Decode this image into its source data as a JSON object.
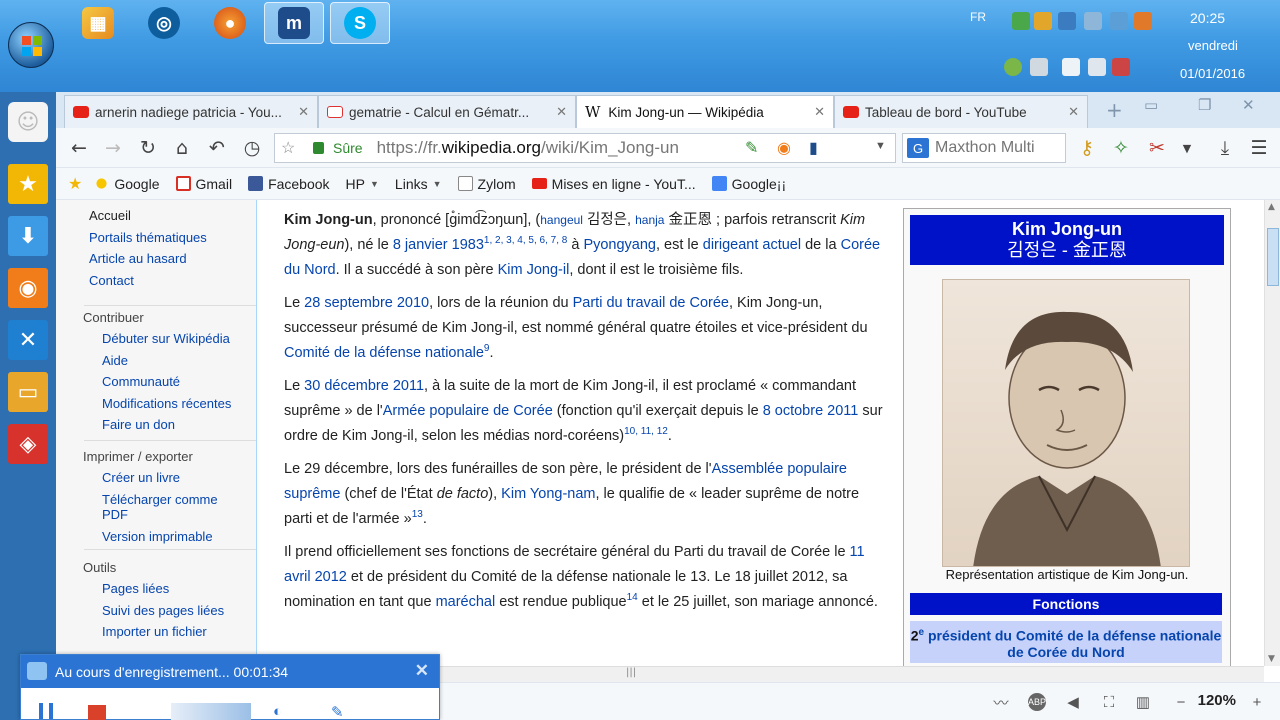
{
  "taskbar": {
    "language": "FR",
    "time": "20:25",
    "day": "vendredi",
    "date": "01/01/2016"
  },
  "tabs": [
    {
      "label": "arnerin nadiege patricia - You...",
      "favicon": "youtube-icon",
      "active": false
    },
    {
      "label": "gematrie - Calcul en Gématr...",
      "favicon": "site-icon",
      "active": false
    },
    {
      "label": "Kim Jong-un — Wikipédia",
      "favicon": "wikipedia-icon",
      "active": true
    },
    {
      "label": "Tableau de bord - YouTube",
      "favicon": "youtube-icon",
      "active": false
    }
  ],
  "address": {
    "secure_label": "Sûre",
    "url_prefix": "https://fr.",
    "url_domain": "wikipedia.org",
    "url_path": "/wiki/Kim_Jong-un"
  },
  "search": {
    "placeholder": "Maxthon Multi"
  },
  "bookmarks": [
    {
      "label": "Google",
      "icon": "sun-icon",
      "dropdown": false
    },
    {
      "label": "Gmail",
      "icon": "gmail-icon",
      "dropdown": false
    },
    {
      "label": "Facebook",
      "icon": "facebook-icon",
      "dropdown": false
    },
    {
      "label": "HP",
      "icon": "",
      "dropdown": true
    },
    {
      "label": "Links",
      "icon": "",
      "dropdown": true
    },
    {
      "label": "Zylom",
      "icon": "page-icon",
      "dropdown": false
    },
    {
      "label": "Mises en ligne - YouT...",
      "icon": "youtube-icon",
      "dropdown": false
    },
    {
      "label": "Google¡¡",
      "icon": "google-icon",
      "dropdown": false
    }
  ],
  "sidebar": {
    "main": [
      "Accueil",
      "Portails thématiques",
      "Article au hasard",
      "Contact"
    ],
    "contribute_head": "Contribuer",
    "contribute": [
      "Débuter sur Wikipédia",
      "Aide",
      "Communauté",
      "Modifications récentes",
      "Faire un don"
    ],
    "print_head": "Imprimer / exporter",
    "print": [
      "Créer un livre",
      "Télécharger comme PDF",
      "Version imprimable"
    ],
    "tools_head": "Outils",
    "tools": [
      "Pages liées",
      "Suivi des pages liées",
      "Importer un fichier"
    ]
  },
  "article": {
    "p1": {
      "bold": "Kim Jong-un",
      "t1": ", prononcé [ɡ̊imd͡zɔŋɯn], (",
      "hangeul_label": "hangeul",
      "hangeul": "김정은",
      "t2": ", ",
      "hanja_label": "hanja",
      "hanja": "金正恩",
      "t3": " ; parfois retranscrit ",
      "alt": "Kim Jong-eun",
      "t4": "), né le ",
      "birth": "8 janvier 1983",
      "refs1": "1, 2, 3, 4, 5, 6, 7, 8",
      "t5": " à ",
      "city": "Pyongyang",
      "t6": ", est le ",
      "role": "dirigeant actuel",
      "t7": " de la ",
      "country": "Corée du Nord",
      "t8": ". Il a succédé à son père ",
      "father": "Kim Jong-il",
      "t9": ", dont il est le troisième fils."
    },
    "p2": {
      "t1": "Le ",
      "date": "28 septembre 2010",
      "t2": ", lors de la réunion du ",
      "party": "Parti du travail de Corée",
      "t3": ", Kim Jong-un, successeur présumé de Kim Jong-il, est nommé général quatre étoiles et vice-président du ",
      "committee": "Comité de la défense nationale",
      "ref": "9",
      "t4": "."
    },
    "p3": {
      "t1": "Le ",
      "date": "30 décembre 2011",
      "t2": ", à la suite de la mort de Kim Jong-il, il est proclamé « commandant suprême » de l'",
      "army": "Armée populaire de Corée",
      "t3": " (fonction qu'il exerçait depuis le ",
      "date2": "8 octobre 2011",
      "t4": " sur ordre de Kim Jong-il, selon les médias nord-coréens)",
      "refs": "10, 11, 12",
      "t5": "."
    },
    "p4": {
      "t1": "Le 29 décembre, lors des funérailles de son père, le président de l'",
      "assembly": "Assemblée populaire suprême",
      "t2": " (chef de l'État ",
      "defacto": "de facto",
      "t3": "), ",
      "name": "Kim Yong-nam",
      "t4": ", le qualifie de « leader suprême de notre parti et de l'armée »",
      "ref": "13",
      "t5": "."
    },
    "p5": {
      "t1": "Il prend officiellement ses fonctions de secrétaire général du Parti du travail de Corée le ",
      "date": "11 avril 2012",
      "t2": " et de président du Comité de la défense nationale le 13. Le 18 juillet 2012, sa nomination en tant que ",
      "rank": "maréchal",
      "t3": " est rendue publique",
      "ref": "14",
      "t4": " et le 25 juillet, son mariage annoncé."
    }
  },
  "infobox": {
    "title": "Kim Jong-un",
    "subtitle": "김정은 - 金正恩",
    "caption": "Représentation artistique de Kim Jong-un.",
    "section": "Fonctions",
    "ordinal": "2",
    "ordinal_sup": "e",
    "office": "président du Comité de la défense nationale de Corée du Nord"
  },
  "statusbar": {
    "zoom": "120%"
  },
  "recorder": {
    "title": "Au cours d'enregistrement... 00:01:34"
  }
}
